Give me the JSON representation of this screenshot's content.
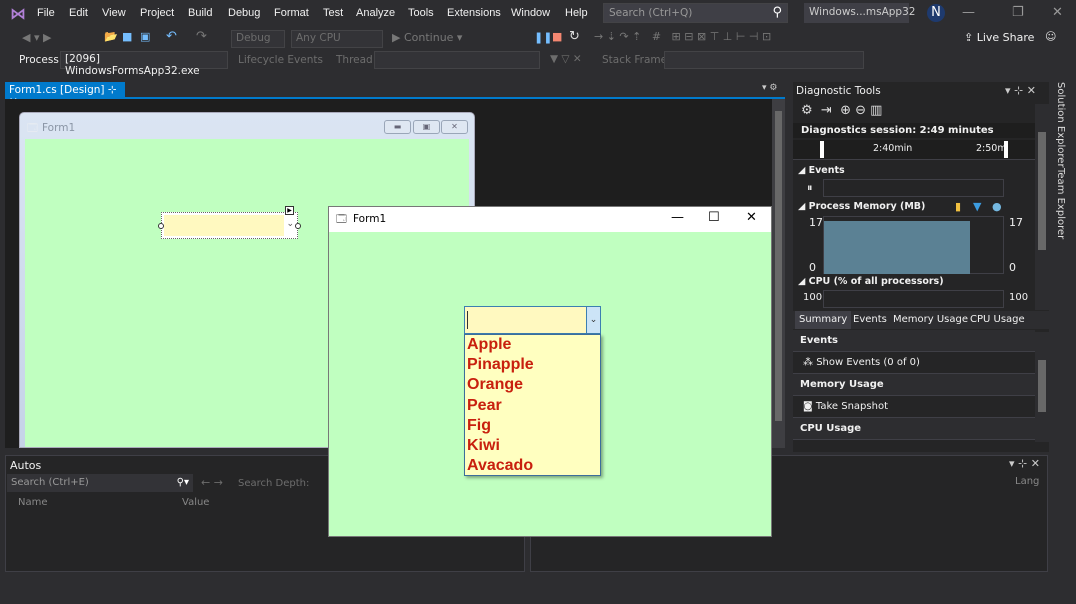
{
  "menu": {
    "items": [
      "File",
      "Edit",
      "View",
      "Project",
      "Build",
      "Debug",
      "Format",
      "Test",
      "Analyze",
      "Tools",
      "Extensions",
      "Window",
      "Help"
    ],
    "search_placeholder": "Search (Ctrl+Q)",
    "project_name": "Windows...msApp32",
    "user_initial": "N"
  },
  "toolbar": {
    "config": "Debug",
    "platform": "Any CPU",
    "continue": "Continue",
    "live_share": "Live Share"
  },
  "process_bar": {
    "process_label": "Process:",
    "process_value": "[2096] WindowsFormsApp32.exe",
    "lifecycle": "Lifecycle Events",
    "thread_label": "Thread:",
    "stack_frame_label": "Stack Frame:"
  },
  "editor": {
    "tab_label": "Form1.cs [Design]",
    "designer_form_title": "Form1"
  },
  "running_form": {
    "title": "Form1",
    "combo_value": "",
    "items": [
      "Apple",
      "Pinapple",
      "Orange",
      "Pear",
      "Fig",
      "Kiwi",
      "Avacado"
    ],
    "colors": {
      "background": "#c0ffc0",
      "combo_background": "#ffffc0",
      "item_text": "#c8200e"
    }
  },
  "autos": {
    "title": "Autos",
    "search_placeholder": "Search (Ctrl+E)",
    "search_depth_label": "Search Depth:",
    "columns": [
      "Name",
      "Value"
    ]
  },
  "diagnostics": {
    "title": "Diagnostic Tools",
    "session": "Diagnostics session: 2:49 minutes",
    "timeline_ticks": [
      "2:40min",
      "2:50m"
    ],
    "events_label": "Events",
    "memory_label": "Process Memory (MB)",
    "memory_max": "17",
    "memory_min": "0",
    "cpu_label": "CPU (% of all processors)",
    "cpu_max": "100",
    "tabs": [
      "Summary",
      "Events",
      "Memory Usage",
      "CPU Usage"
    ],
    "active_tab": "Summary",
    "sections": [
      {
        "header": "Events",
        "action": "Show Events (0 of 0)"
      },
      {
        "header": "Memory Usage",
        "action": "Take Snapshot"
      },
      {
        "header": "CPU Usage",
        "action": ""
      }
    ]
  },
  "side_tabs": [
    "Solution Explorer",
    "Team Explorer"
  ],
  "bottom_panel": {
    "column": "Lang"
  }
}
